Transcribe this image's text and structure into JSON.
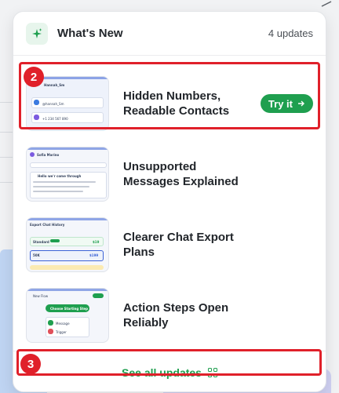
{
  "header": {
    "title": "What's New",
    "count": "4 updates"
  },
  "items": [
    {
      "title": "Hidden Numbers, Readable Contacts",
      "cta": "Try it",
      "thumb": {
        "name": "Hannah_Sm",
        "username": "@hannah_Sm",
        "phone": "+1 234 567 890"
      }
    },
    {
      "title": "Unsupported Messages Explained",
      "thumb": {
        "name": "Sofia Marino",
        "note": "Hello we'r come through"
      }
    },
    {
      "title": "Clearer Chat Export Plans",
      "thumb": {
        "heading": "Export Chat History",
        "plan1": "Standard",
        "plan1_price": "$19",
        "plan2": "50K",
        "plan2_price": "$199"
      }
    },
    {
      "title": "Action Steps Open Reliably",
      "thumb": {
        "heading": "New Flow",
        "step": "Choose Starting Step",
        "option1": "Message",
        "option2": "Trigger"
      }
    }
  ],
  "footer": {
    "see_all": "See all updates"
  },
  "annotations": {
    "badge_2": "2",
    "badge_3": "3"
  },
  "colors": {
    "accent": "#1f9f4f",
    "highlight": "#e0202a"
  }
}
